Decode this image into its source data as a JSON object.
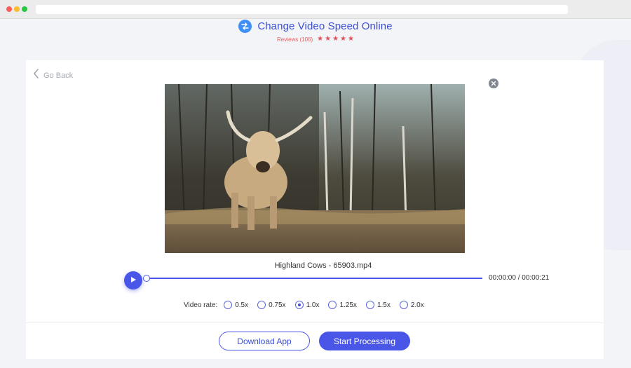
{
  "header": {
    "title": "Change Video Speed Online",
    "reviews": "Reviews (106)",
    "stars": [
      "★",
      "★",
      "★",
      "★",
      "★"
    ],
    "brand_icon": "speed-change-icon"
  },
  "nav": {
    "go_back_label": "Go Back",
    "back_icon": "chevron-left-icon",
    "close_icon": "close-circle-icon"
  },
  "video": {
    "filename": "Highland Cows - 65903.mp4",
    "thumbnail": "highland-cow-photo"
  },
  "player": {
    "play_icon": "play-icon",
    "time": "00:00:00 / 00:00:21",
    "progress": 0
  },
  "rate": {
    "label": "Video rate:",
    "options": [
      "0.5x",
      "0.75x",
      "1.0x",
      "1.25x",
      "1.5x",
      "2.0x"
    ],
    "selected": "1.0x"
  },
  "actions": {
    "download_label": "Download App",
    "start_label": "Start Processing"
  },
  "colors": {
    "accent": "#4a56e8",
    "title": "#3b4fd8",
    "reviews": "#e05f5f",
    "star": "#e0525a"
  }
}
